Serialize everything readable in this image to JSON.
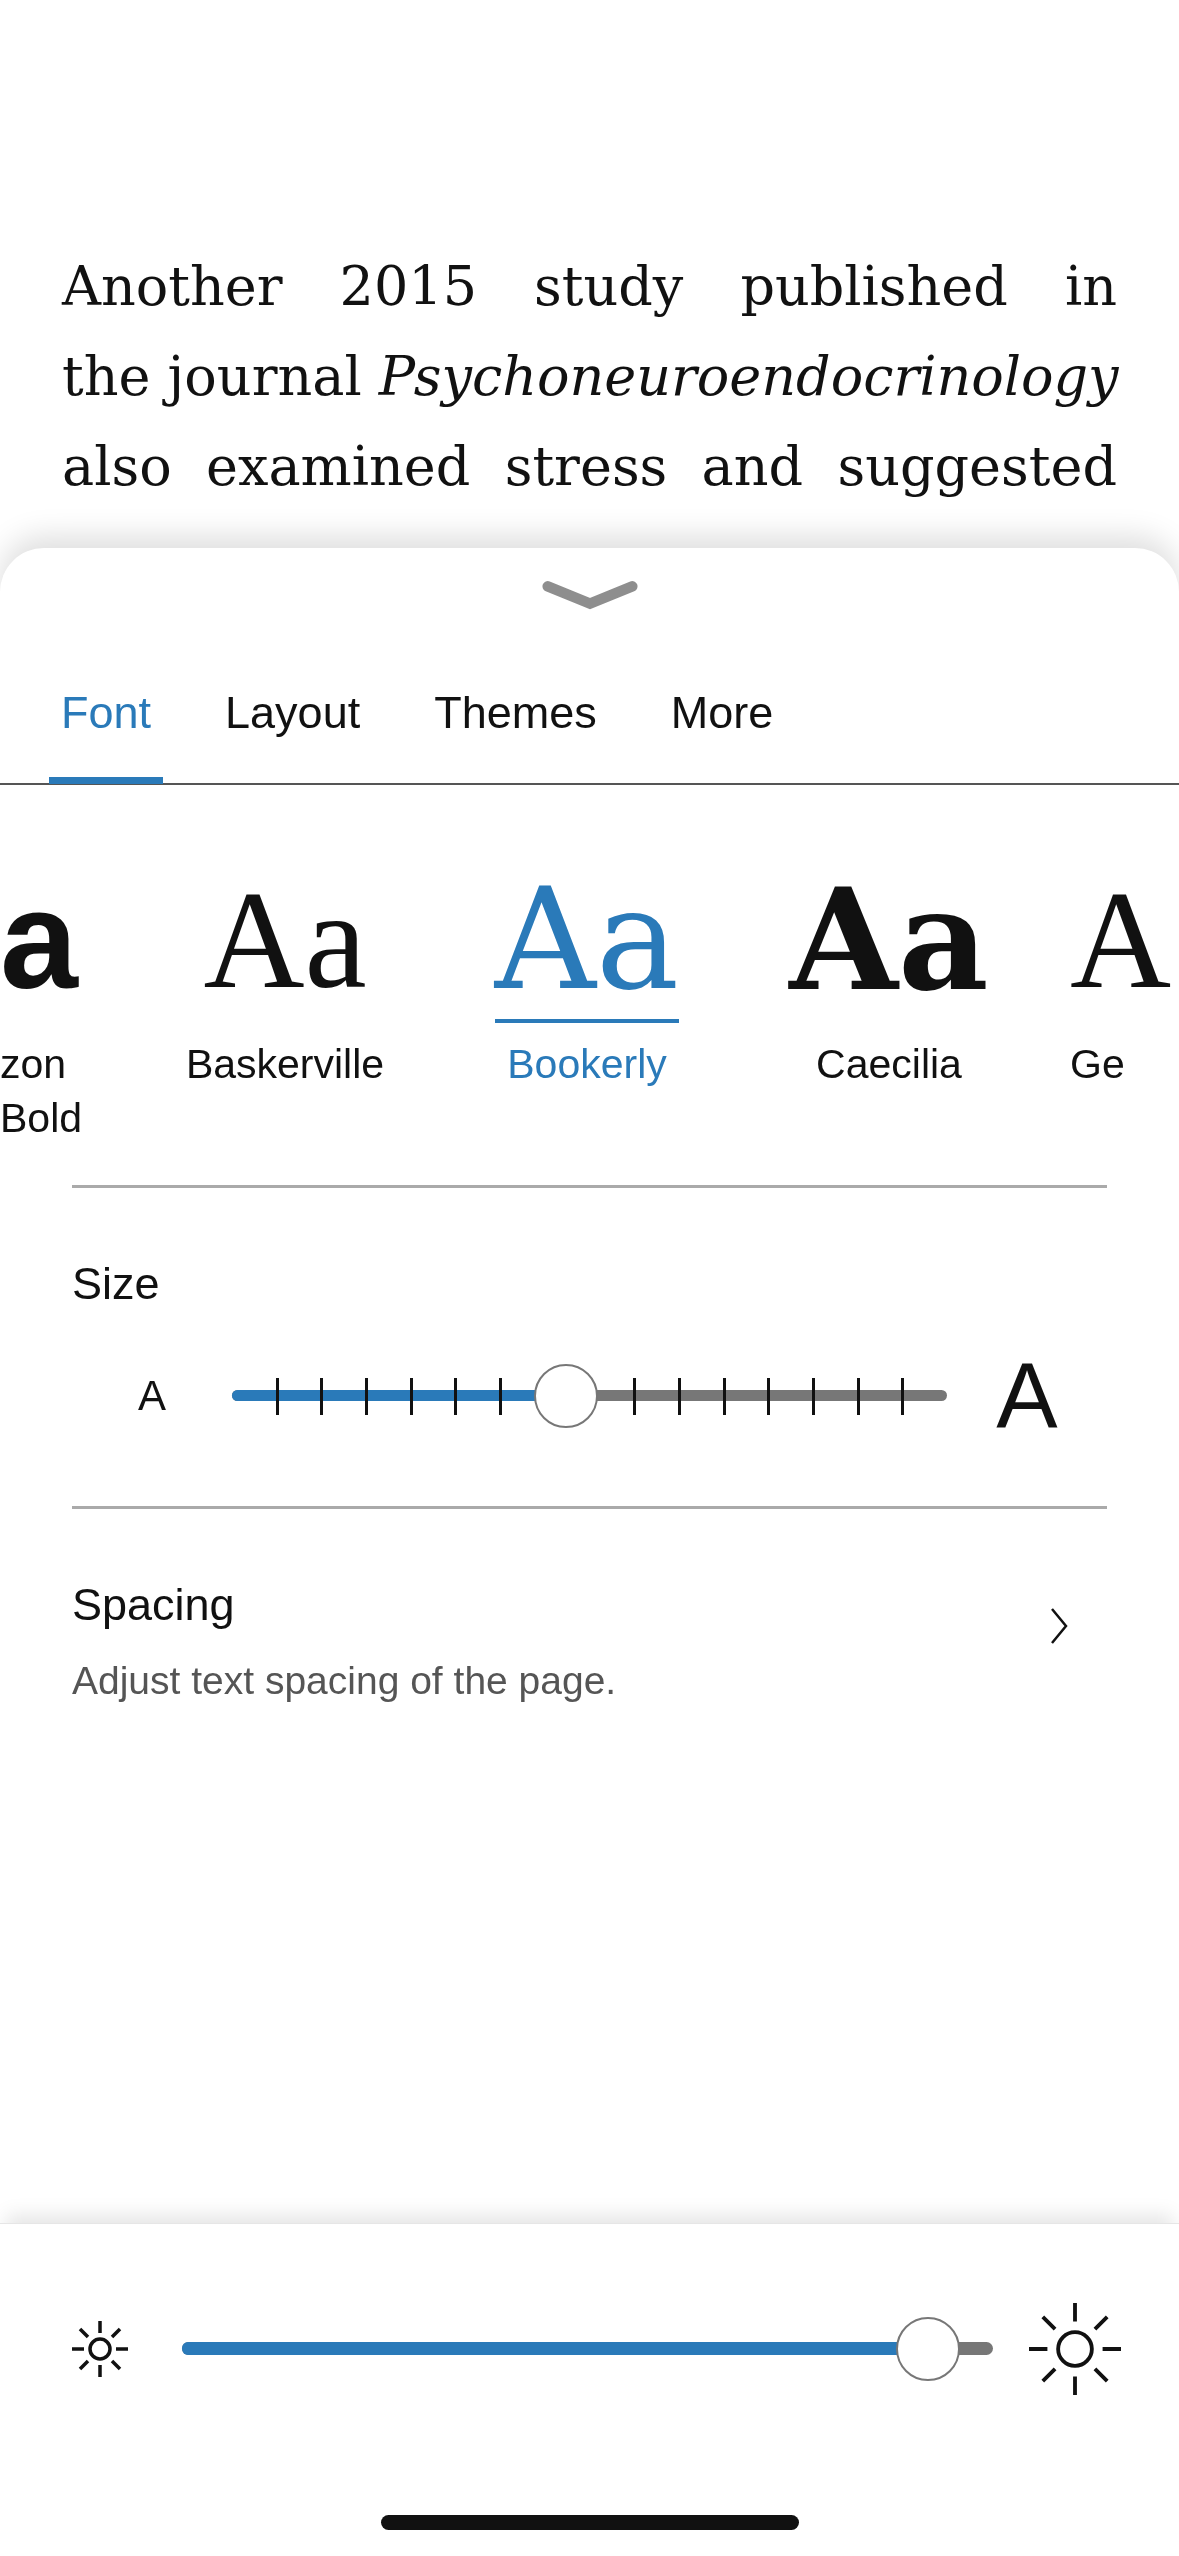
{
  "body_text": {
    "lines": [
      "Another 2015 study published in",
      "the journal *Psychoneuroendocrinology*",
      "also examined stress and suggested"
    ]
  },
  "tabs": [
    {
      "label": "Font",
      "selected": true
    },
    {
      "label": "Layout",
      "selected": false
    },
    {
      "label": "Themes",
      "selected": false
    },
    {
      "label": "More",
      "selected": false
    }
  ],
  "fonts": [
    {
      "sample": "a",
      "label": "zon Bold",
      "selected": false
    },
    {
      "sample": "Aa",
      "label": "Baskerville",
      "selected": false
    },
    {
      "sample": "Aa",
      "label": "Bookerly",
      "selected": true
    },
    {
      "sample": "Aa",
      "label": "Caecilia",
      "selected": false
    },
    {
      "sample": "A",
      "label": "Ge",
      "selected": false
    }
  ],
  "size": {
    "title": "Size",
    "small_label": "A",
    "large_label": "A",
    "level": 0.467
  },
  "spacing": {
    "title": "Spacing",
    "subtitle": "Adjust text spacing of the page."
  },
  "brightness": {
    "level": 0.92
  }
}
